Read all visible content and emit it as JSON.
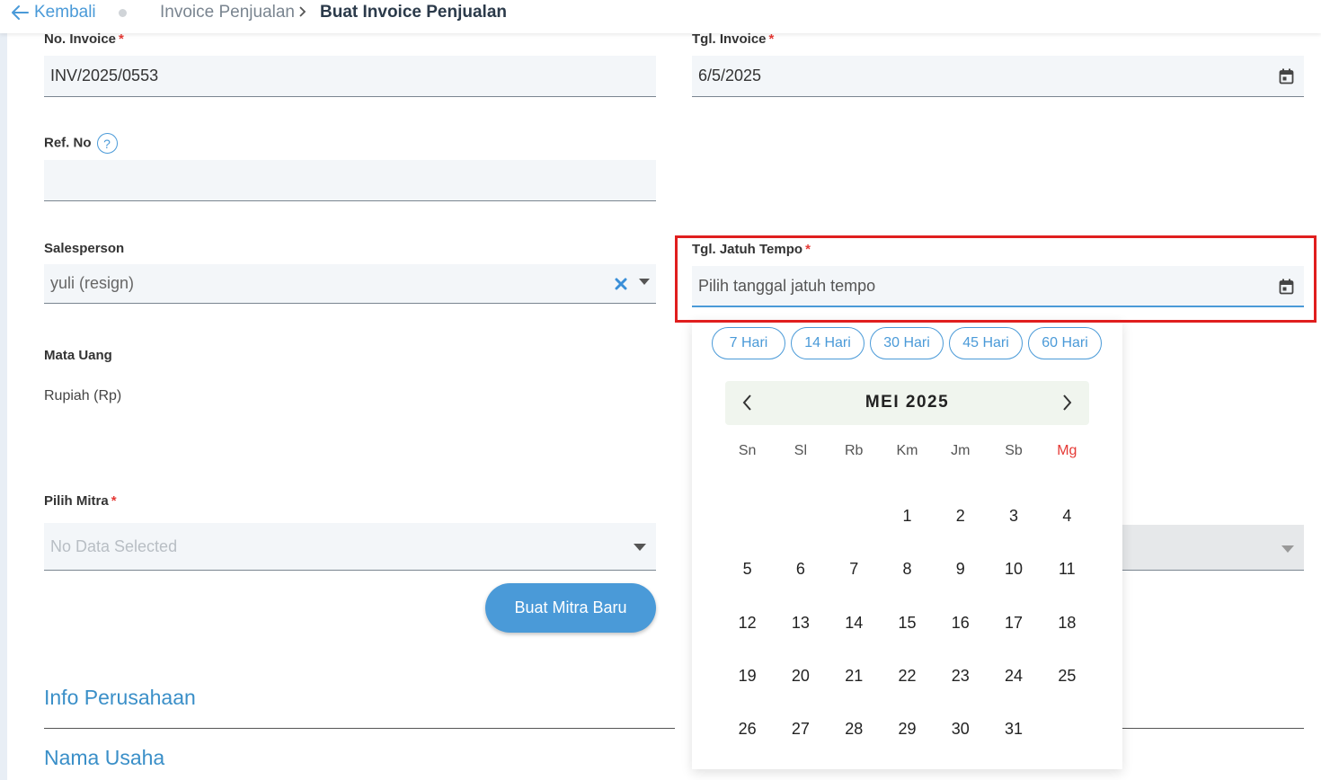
{
  "header": {
    "back_label": "Kembali",
    "crumb_parent": "Invoice Penjualan",
    "crumb_current": "Buat Invoice Penjualan"
  },
  "form": {
    "no_invoice": {
      "label": "No. Invoice",
      "required": "*",
      "value": "INV/2025/0553"
    },
    "tgl_invoice": {
      "label": "Tgl. Invoice",
      "required": "*",
      "value": "6/5/2025"
    },
    "ref_no": {
      "label": "Ref. No",
      "help": "?",
      "value": ""
    },
    "salesperson": {
      "label": "Salesperson",
      "value": "yuli (resign)"
    },
    "tgl_jatuh_tempo": {
      "label": "Tgl. Jatuh Tempo",
      "required": "*",
      "placeholder": "Pilih tanggal jatuh tempo"
    },
    "mata_uang": {
      "label": "Mata Uang",
      "value": "Rupiah (Rp)"
    },
    "pilih_mitra": {
      "label": "Pilih Mitra",
      "required": "*",
      "placeholder": "No Data Selected"
    },
    "buat_mitra_label": "Buat Mitra Baru"
  },
  "quick_terms": [
    "7 Hari",
    "14 Hari",
    "30 Hari",
    "45 Hari",
    "60 Hari"
  ],
  "calendar": {
    "month_label": "MEI 2025",
    "weekdays": [
      "Sn",
      "Sl",
      "Rb",
      "Km",
      "Jm",
      "Sb",
      "Mg"
    ],
    "weeks": [
      [
        "",
        "",
        "",
        "1",
        "2",
        "3",
        "4"
      ],
      [
        "5",
        "6",
        "7",
        "8",
        "9",
        "10",
        "11"
      ],
      [
        "12",
        "13",
        "14",
        "15",
        "16",
        "17",
        "18"
      ],
      [
        "19",
        "20",
        "21",
        "22",
        "23",
        "24",
        "25"
      ],
      [
        "26",
        "27",
        "28",
        "29",
        "30",
        "31",
        ""
      ]
    ]
  },
  "sections": {
    "info_perusahaan": "Info Perusahaan",
    "nama_usaha": "Nama Usaha"
  },
  "colors": {
    "accent": "#4a9ad8",
    "required": "#e53935",
    "highlight": "#e01e1e"
  }
}
